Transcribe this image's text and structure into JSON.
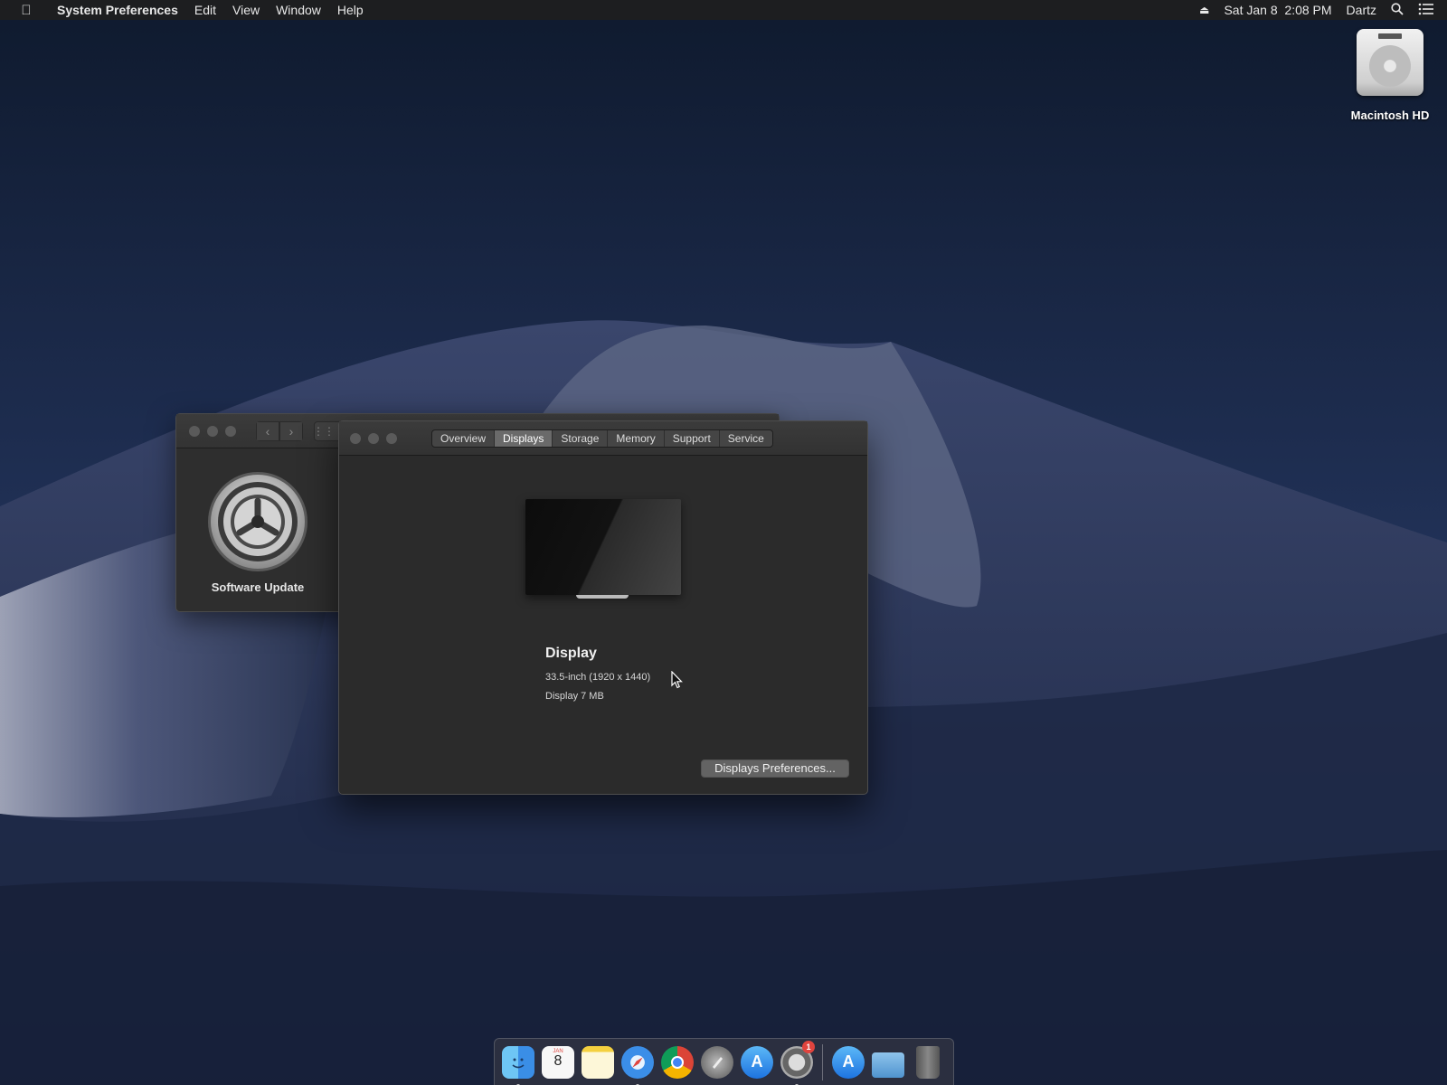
{
  "menubar": {
    "app_name": "System Preferences",
    "items": [
      "Edit",
      "View",
      "Window",
      "Help"
    ],
    "date": "Sat Jan 8",
    "time": "2:08 PM",
    "user": "Dartz"
  },
  "desktop": {
    "icons": [
      {
        "label": "Macintosh HD",
        "icon": "hard-drive-icon"
      }
    ]
  },
  "system_preferences": {
    "pane_label": "Software Update"
  },
  "about_window": {
    "tabs": [
      "Overview",
      "Displays",
      "Storage",
      "Memory",
      "Support",
      "Service"
    ],
    "active_tab": "Displays",
    "display_title": "Display",
    "display_spec": "33.5-inch (1920 x 1440)",
    "display_memory": "Display 7 MB",
    "prefs_button": "Displays Preferences..."
  },
  "dock": {
    "badge_count": "1",
    "calendar_day": "8",
    "calendar_month": "JAN",
    "apps": [
      "finder-icon",
      "calendar-icon",
      "notes-icon",
      "safari-icon",
      "chrome-icon",
      "launchpad-icon",
      "app-store-icon",
      "system-preferences-icon",
      "app-store-folder-icon",
      "downloads-folder-icon",
      "trash-icon"
    ]
  },
  "colors": {
    "badge": "#e0443e",
    "active_tab": "#6a6a6a"
  }
}
